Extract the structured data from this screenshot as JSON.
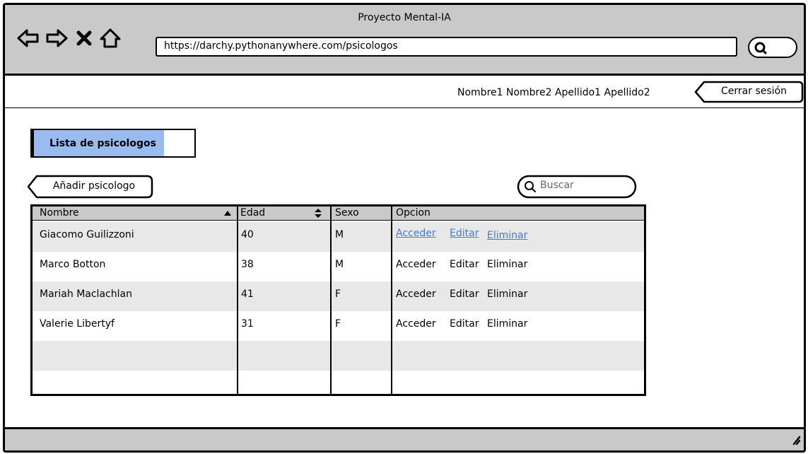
{
  "window": {
    "title": "Proyecto Mental-IA"
  },
  "browser": {
    "url": "https://darchy.pythonanywhere.com/psicologos"
  },
  "header": {
    "user_name": "Nombre1 Nombre2 Apellido1 Apellido2",
    "logout_label": "Cerrar sesión"
  },
  "page": {
    "section_title": "Lista de psicologos",
    "add_button_label": "Añadir psicologo",
    "search_placeholder": "Buscar"
  },
  "table": {
    "columns": [
      "Nombre",
      "Edad",
      "Sexo",
      "Opcion"
    ],
    "rows": [
      {
        "nombre": "Giacomo Guilizzoni",
        "edad": "40",
        "sexo": "M",
        "acceder": "Acceder",
        "editar": "Editar",
        "eliminar": "Eliminar"
      },
      {
        "nombre": "Marco Botton",
        "edad": "38",
        "sexo": "M",
        "acceder": "Acceder",
        "editar": "Editar",
        "eliminar": "Eliminar"
      },
      {
        "nombre": "Mariah Maclachlan",
        "edad": "41",
        "sexo": "F",
        "acceder": "Acceder",
        "editar": "Editar",
        "eliminar": "Eliminar"
      },
      {
        "nombre": "Valerie Libertyf",
        "edad": "31",
        "sexo": "F",
        "acceder": "Acceder",
        "editar": "Editar",
        "eliminar": "Eliminar"
      }
    ]
  },
  "icons": [
    "back-arrow-icon",
    "forward-arrow-icon",
    "close-icon",
    "home-icon",
    "search-icon",
    "sort-up-icon",
    "sort-updown-icon",
    "resize-grip-icon"
  ],
  "colors": {
    "chrome": "#c9c9c9",
    "title_fill": "#99bbee",
    "link": "#3a7cd8",
    "row_shade": "#e8e8e8"
  }
}
